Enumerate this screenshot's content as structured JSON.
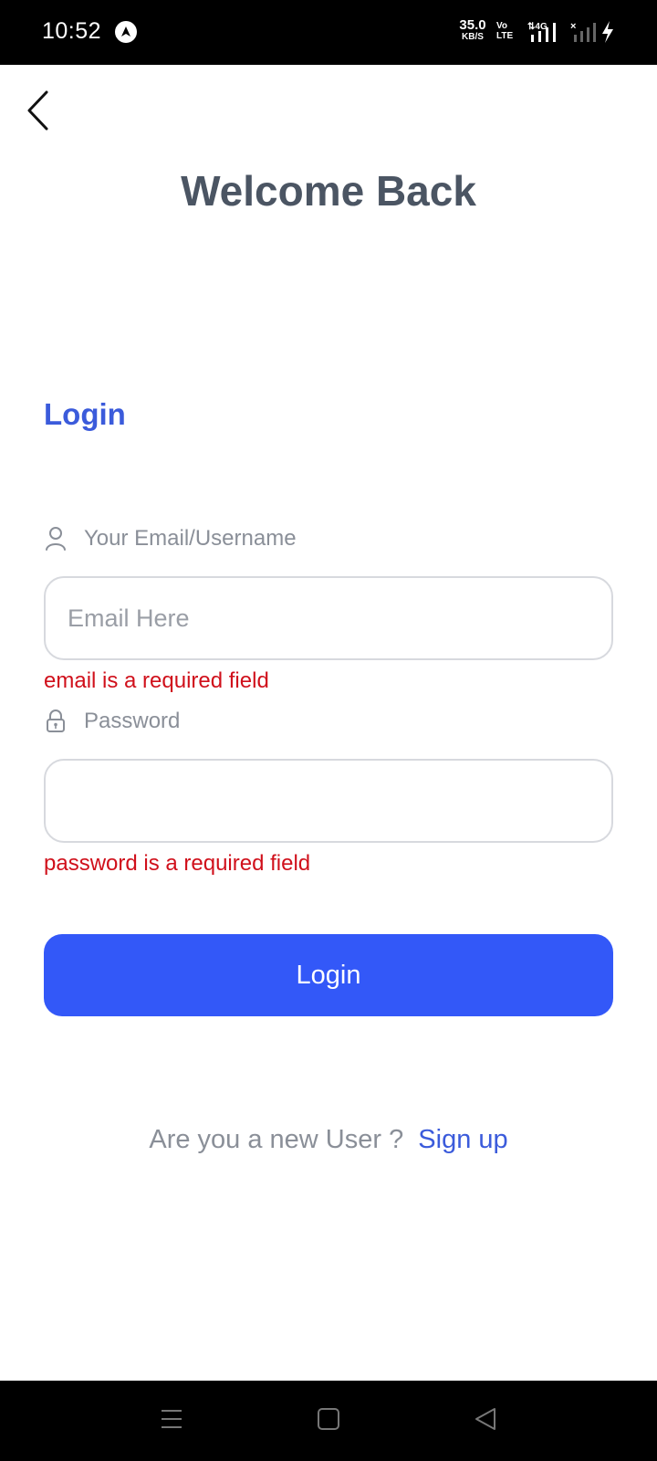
{
  "status_bar": {
    "time": "10:52",
    "net_speed_value": "35.0",
    "net_speed_unit": "KB/S",
    "volte_top": "Vo",
    "volte_bottom": "LTE",
    "network_type": "4G",
    "app_icon": "navigation-arrow-icon",
    "battery_state": "charging"
  },
  "header": {
    "back_icon": "chevron-left-icon",
    "title": "Welcome Back"
  },
  "form": {
    "heading": "Login",
    "email": {
      "label": "Your Email/Username",
      "icon": "user-icon",
      "value": "",
      "placeholder": "Email Here",
      "error": "email is a required field"
    },
    "password": {
      "label": "Password",
      "icon": "lock-icon",
      "value": "",
      "placeholder": "",
      "error": "password is a required field"
    },
    "submit_label": "Login"
  },
  "footer": {
    "prompt": "Are you a new User ?",
    "signup_label": "Sign up"
  },
  "colors": {
    "accent": "#3358f8",
    "heading_blue": "#3b5bdb",
    "error": "#d0101b",
    "title_gray": "#4b5563",
    "label_gray": "#8a8f98"
  }
}
